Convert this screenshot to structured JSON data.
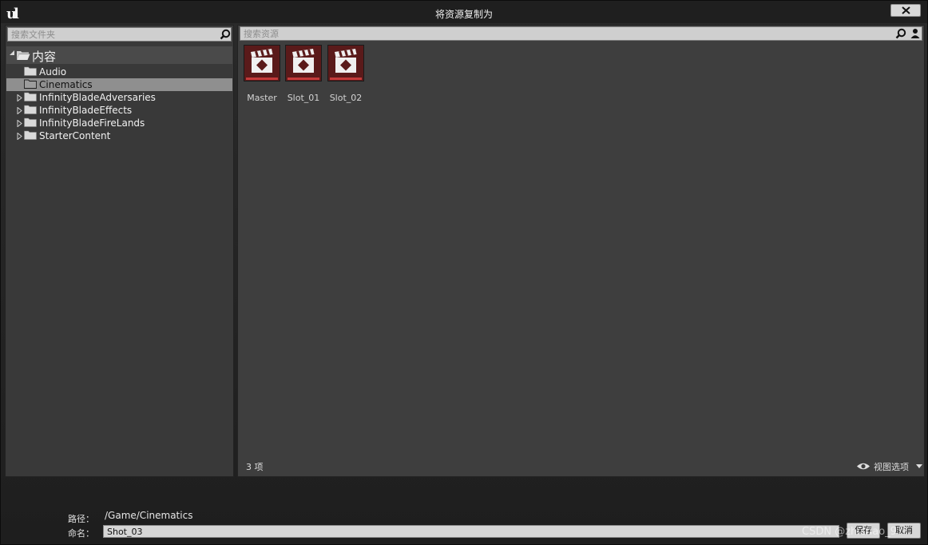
{
  "window": {
    "title": "将资源复制为"
  },
  "folder_panel": {
    "search_placeholder": "搜索文件夹",
    "tree": [
      {
        "label": "内容",
        "expanded": true,
        "root": true
      },
      {
        "label": "Audio"
      },
      {
        "label": "Cinematics",
        "selected": true
      },
      {
        "label": "InfinityBladeAdversaries",
        "has_children": true
      },
      {
        "label": "InfinityBladeEffects",
        "has_children": true
      },
      {
        "label": "InfinityBladeFireLands",
        "has_children": true
      },
      {
        "label": "StarterContent",
        "has_children": true
      }
    ]
  },
  "asset_panel": {
    "search_placeholder": "搜索资源",
    "assets": [
      {
        "label": "Master",
        "icon": "clapperboard-icon"
      },
      {
        "label": "Slot_01",
        "icon": "clapperboard-icon"
      },
      {
        "label": "Slot_02",
        "icon": "clapperboard-icon"
      }
    ],
    "item_count": "3 项",
    "view_options_label": "视图选项"
  },
  "footer": {
    "path_label": "路径：",
    "path_value": "/Game/Cinematics",
    "name_label": "命名：",
    "name_value": "Shot_03",
    "save_label": "保存",
    "cancel_label": "取消"
  },
  "watermark": "CSDN @zhichao_97",
  "colors": {
    "selected_row": "#8f8f8f",
    "asset_tile": "#5a1a1a",
    "asset_bar": "#c43a3a"
  }
}
